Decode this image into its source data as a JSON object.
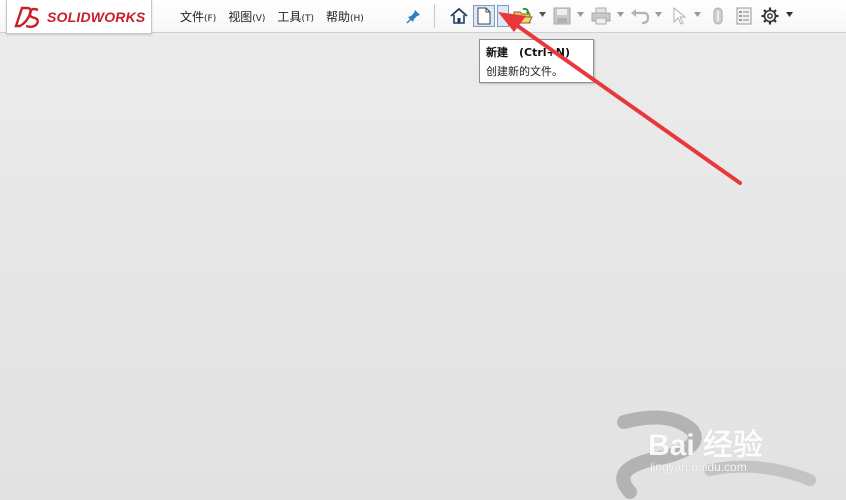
{
  "app": {
    "logo_text": "SOLIDWORKS",
    "brand_color": "#c8202a"
  },
  "menu": [
    {
      "label": "文件",
      "accel": "(F)"
    },
    {
      "label": "视图",
      "accel": "(V)"
    },
    {
      "label": "工具",
      "accel": "(T)"
    },
    {
      "label": "帮助",
      "accel": "(H)"
    }
  ],
  "toolbar": {
    "icons": [
      "home-icon",
      "new-document-icon",
      "open-folder-icon",
      "save-icon",
      "print-icon",
      "undo-icon",
      "select-pointer-icon",
      "rebuild-icon",
      "file-properties-icon",
      "options-gear-icon"
    ]
  },
  "tooltip": {
    "title": "新建　(Ctrl+N)",
    "description": "创建新的文件。"
  },
  "annotation": {
    "arrow_color": "#e8383c"
  },
  "watermark": {
    "brand": "Bai 经验",
    "url": "jingyan.baidu.com"
  }
}
